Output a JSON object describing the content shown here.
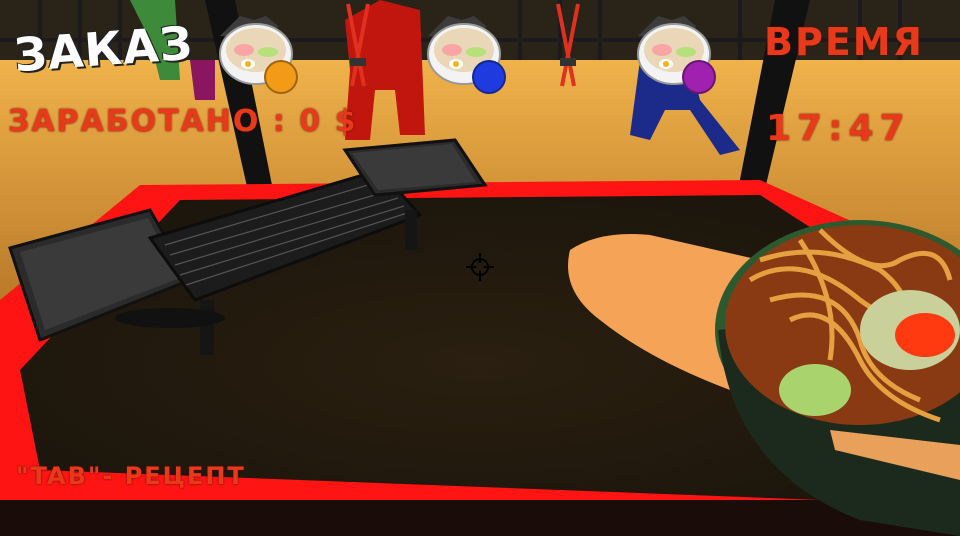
{
  "hud": {
    "order_title": "ЗАКАЗ",
    "earned_label": "ЗАРАБОТАНО : 0 $",
    "time_label": "ВРЕМЯ",
    "time_value": "17:47",
    "recipe_hint": "\"TAB\"- РЕЦЕПТ"
  },
  "orders": [
    {
      "icon": "ramen-bowl-icon",
      "color": "#f39a16"
    },
    {
      "icon": "ramen-bowl-icon",
      "color": "#1f3be0"
    },
    {
      "icon": "ramen-bowl-icon",
      "color": "#a020b0"
    }
  ],
  "colors": {
    "hud_red": "#e83a1a",
    "counter_red": "#ff1a1a",
    "table": "#2a1f12"
  }
}
